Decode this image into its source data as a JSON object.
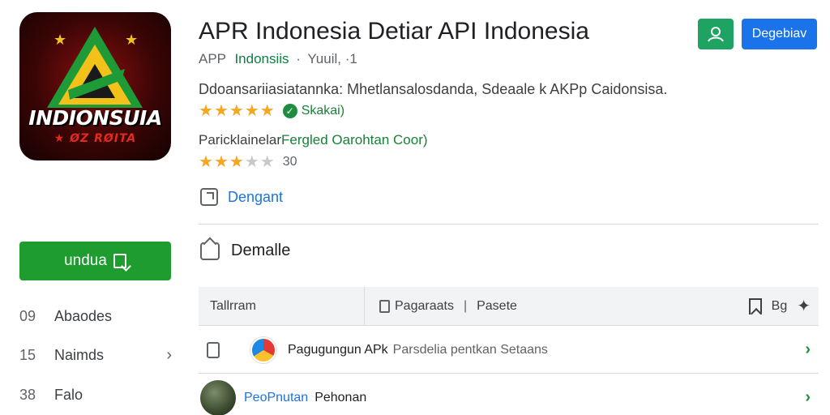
{
  "app": {
    "title": "APR Indonesia Detiar API Indonesia",
    "category": "APP",
    "developer": "Indonsiis",
    "bullet": "·",
    "meta_extra": "Yuuil, ·1",
    "description": "Ddoansariiasiatannka: Mhetlansalosdanda, Sdeaale k AKPp Caidonsisa.",
    "icon": {
      "name": "app-logo",
      "title": "INDIONSUIA",
      "subtitle": "★ ØZ RØITA"
    }
  },
  "rating1": {
    "value": 4.5,
    "max": 5,
    "badge_label": "Skakai)",
    "badge_icon": "check-circle-icon"
  },
  "feature": {
    "prefix": "Paricklainelar",
    "highlight": "Fergled Oarohtan Coor)"
  },
  "rating2": {
    "value": 2.5,
    "max": 5,
    "count": "30"
  },
  "link": {
    "label": "Dengant",
    "icon": "external-link-icon"
  },
  "buttons": {
    "user_icon": "user-icon",
    "primary_label": "Degebiav"
  },
  "sidebar": {
    "download_label": "undua",
    "download_icon": "download-icon",
    "items": [
      {
        "num": "09",
        "label": "Abaodes",
        "chevron": ""
      },
      {
        "num": "15",
        "label": "Naimds",
        "chevron": "›"
      },
      {
        "num": "38",
        "label": "Falo",
        "chevron": ""
      }
    ]
  },
  "section": {
    "title": "Demalle",
    "icon": "share-icon"
  },
  "table": {
    "col1": "Tallrram",
    "col2a": "Pagaraats",
    "col2sep": "|",
    "col2b": "Pasete",
    "right_label": "Bg",
    "rows": [
      {
        "title": "Pagugungun APk",
        "subtitle": "Parsdelia pentkan Setaans"
      },
      {
        "title": "PeoPnutan",
        "subtitle": "Pehonan"
      }
    ]
  },
  "colors": {
    "primary_blue": "#1a73e8",
    "download_green": "#1e9c2f",
    "star": "#f5a623",
    "developer_green": "#0b8043"
  }
}
